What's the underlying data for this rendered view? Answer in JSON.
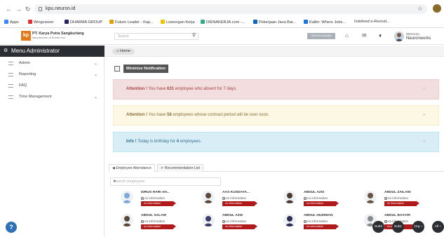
{
  "browser": {
    "url": "kpu.neuron.id",
    "bookmarks": [
      {
        "label": "Apps",
        "color": "#4285f4"
      },
      {
        "label": "Wingcareer",
        "color": "#d33"
      },
      {
        "label": "DHARMA GROUP",
        "color": "#226"
      },
      {
        "label": "Future Leader - Kap...",
        "color": "#e0a000"
      },
      {
        "label": "Lowongan Kerja",
        "color": "#f3c200"
      },
      {
        "label": "DIENAKERJA.com -...",
        "color": "#3a8"
      },
      {
        "label": "Pekerjaan Java Bar...",
        "color": "#0a66c2"
      },
      {
        "label": "Kalibr: Where Jobs...",
        "color": "#1a73e8"
      },
      {
        "label": "Indofood e-Recruit...",
        "color": "#c33"
      }
    ]
  },
  "header": {
    "company_name": "PT. Karya Putra Sangkuriang",
    "company_sub": "Manufacturer of Rubber Ind.",
    "search_placeholder": "Search",
    "shift_label": "Shift Not Available",
    "welcome": "Welcome,",
    "user_name": "Neuronworks"
  },
  "sidebar": {
    "title": "Menu Administrator",
    "items": [
      {
        "label": "Admin",
        "has_children": true
      },
      {
        "label": "Reporting",
        "has_children": true
      },
      {
        "label": "FAQ",
        "has_children": false
      },
      {
        "label": "Time Management",
        "has_children": true
      }
    ]
  },
  "breadcrumb": {
    "home": "Home"
  },
  "minimize_label": "Minimize Notification",
  "alerts": {
    "danger": {
      "prefix": "Attention !",
      "pre": "You have",
      "count": "631",
      "post": "employee who absent for 7 days."
    },
    "warning": {
      "prefix": "Attention !",
      "pre": "You have",
      "count": "58",
      "post": "employees whose contract period will be over soon."
    },
    "info": {
      "prefix": "Info !",
      "pre": "Today is birthday for",
      "count": "4",
      "post": "employees."
    }
  },
  "tabs": {
    "attendance": "Employee Attendance",
    "recommendation": "Recommendation List"
  },
  "employee_search_placeholder": "Search employee",
  "employees": [
    {
      "name": "IDRUS HARI AH...",
      "status": "no information",
      "badge": "no information",
      "face": "#7fa9d8"
    },
    {
      "name": "AAS KUSDAYA...",
      "status": "no information",
      "badge": "no information",
      "face": "#5d4a3a"
    },
    {
      "name": "ABDUL AZIS",
      "status": "no information",
      "badge": "no information",
      "face": "#4b3a30"
    },
    {
      "name": "ABDUL ZAILANI",
      "status": "no information",
      "badge": "no information",
      "face": "#6b5444"
    },
    {
      "name": "ABDUL SALAM",
      "status": "no information",
      "badge": "no information",
      "face": "#5a4636"
    },
    {
      "name": "ABDUL AZIZ",
      "status": "no information",
      "badge": "no information",
      "face": "#3d3d6b"
    },
    {
      "name": "ABDUL HUDIMAN",
      "status": "no information",
      "badge": "no information",
      "face": "#2f2f55"
    },
    {
      "name": "ABDUL BASYIR",
      "status": "no information",
      "badge": "no information",
      "face": "#8a8a8a"
    }
  ],
  "floating": [
    "Sub2",
    "Sub1",
    "Org ~",
    "All ~"
  ],
  "help": "?"
}
